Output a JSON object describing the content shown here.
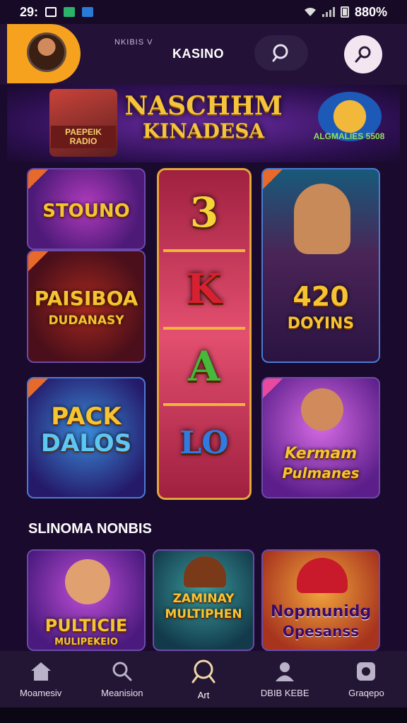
{
  "status_bar": {
    "time": "29:",
    "battery": "880%"
  },
  "header": {
    "subtitle": "NKIBIS V",
    "title": "KASINO"
  },
  "banner": {
    "title_line1": "NASCHHM",
    "title_line2": "KINADESA",
    "left_label": "PAEPEIK RADIO",
    "right_label": "ALGMALIES 5508"
  },
  "tiles": {
    "stouno": "STOUNO",
    "paisiboa_line1": "PAISIBOA",
    "paisiboa_line2": "DUDANASY",
    "slot_symbols": [
      "3",
      "K",
      "A",
      "LO"
    ],
    "hero_line1": "420",
    "hero_line2": "DOYINS",
    "pack_line1": "PACK",
    "pack_line2": "DALOS",
    "kermam_line1": "Kermam",
    "kermam_line2": "Pulmanes"
  },
  "section": {
    "title": "SLINOMA NONBIS",
    "tiles": [
      {
        "line1": "PULTICIE",
        "line2": "MULIPEKEIO"
      },
      {
        "line1": "ZAMINAY",
        "line2": "MULTIPHEN"
      },
      {
        "line1": "Nopmunidg",
        "line2": "Opesanss"
      }
    ]
  },
  "nav": [
    {
      "label": "Moamesiv",
      "icon": "home-icon"
    },
    {
      "label": "Meanision",
      "icon": "search-icon"
    },
    {
      "label": "Art",
      "icon": "search-ring-icon"
    },
    {
      "label": "DBIB KEBE",
      "icon": "person-icon"
    },
    {
      "label": "Graqepo",
      "icon": "badge-icon"
    }
  ],
  "colors": {
    "background": "#1a0a2e",
    "accent_orange": "#f6a21e",
    "gold": "#f6c332"
  }
}
